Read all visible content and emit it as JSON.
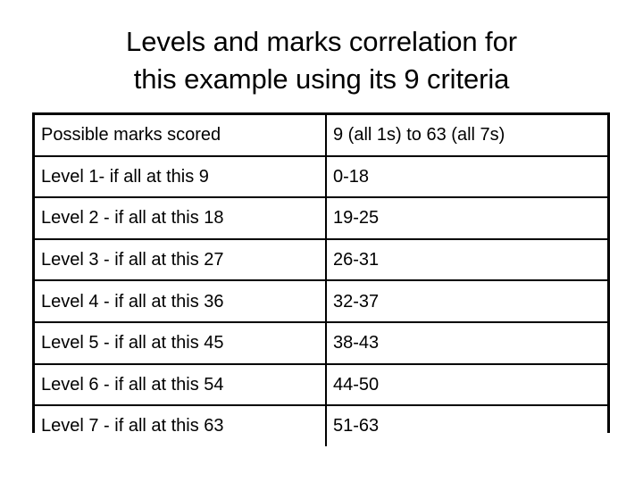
{
  "slide": {
    "title": "Levels and marks correlation for\nthis example using its 9 criteria",
    "background_color": "#ffffff",
    "text_color": "#000000",
    "border_color": "#000000"
  },
  "table": {
    "rows": [
      {
        "label": "Possible marks scored",
        "value": "9 (all 1s) to 63 (all 7s)"
      },
      {
        "label": "Level 1- if all at this 9",
        "value": "0-18"
      },
      {
        "label": "Level 2 - if all at this 18",
        "value": "19-25"
      },
      {
        "label": "Level 3 - if all at this 27",
        "value": "26-31"
      },
      {
        "label": "Level 4 - if all at this 36",
        "value": "32-37"
      },
      {
        "label": "Level 5 - if all at this 45",
        "value": "38-43"
      },
      {
        "label": "Level 6 - if all at this 54",
        "value": "44-50"
      },
      {
        "label": "Level 7 - if all at this 63",
        "value": "51-63"
      }
    ]
  }
}
